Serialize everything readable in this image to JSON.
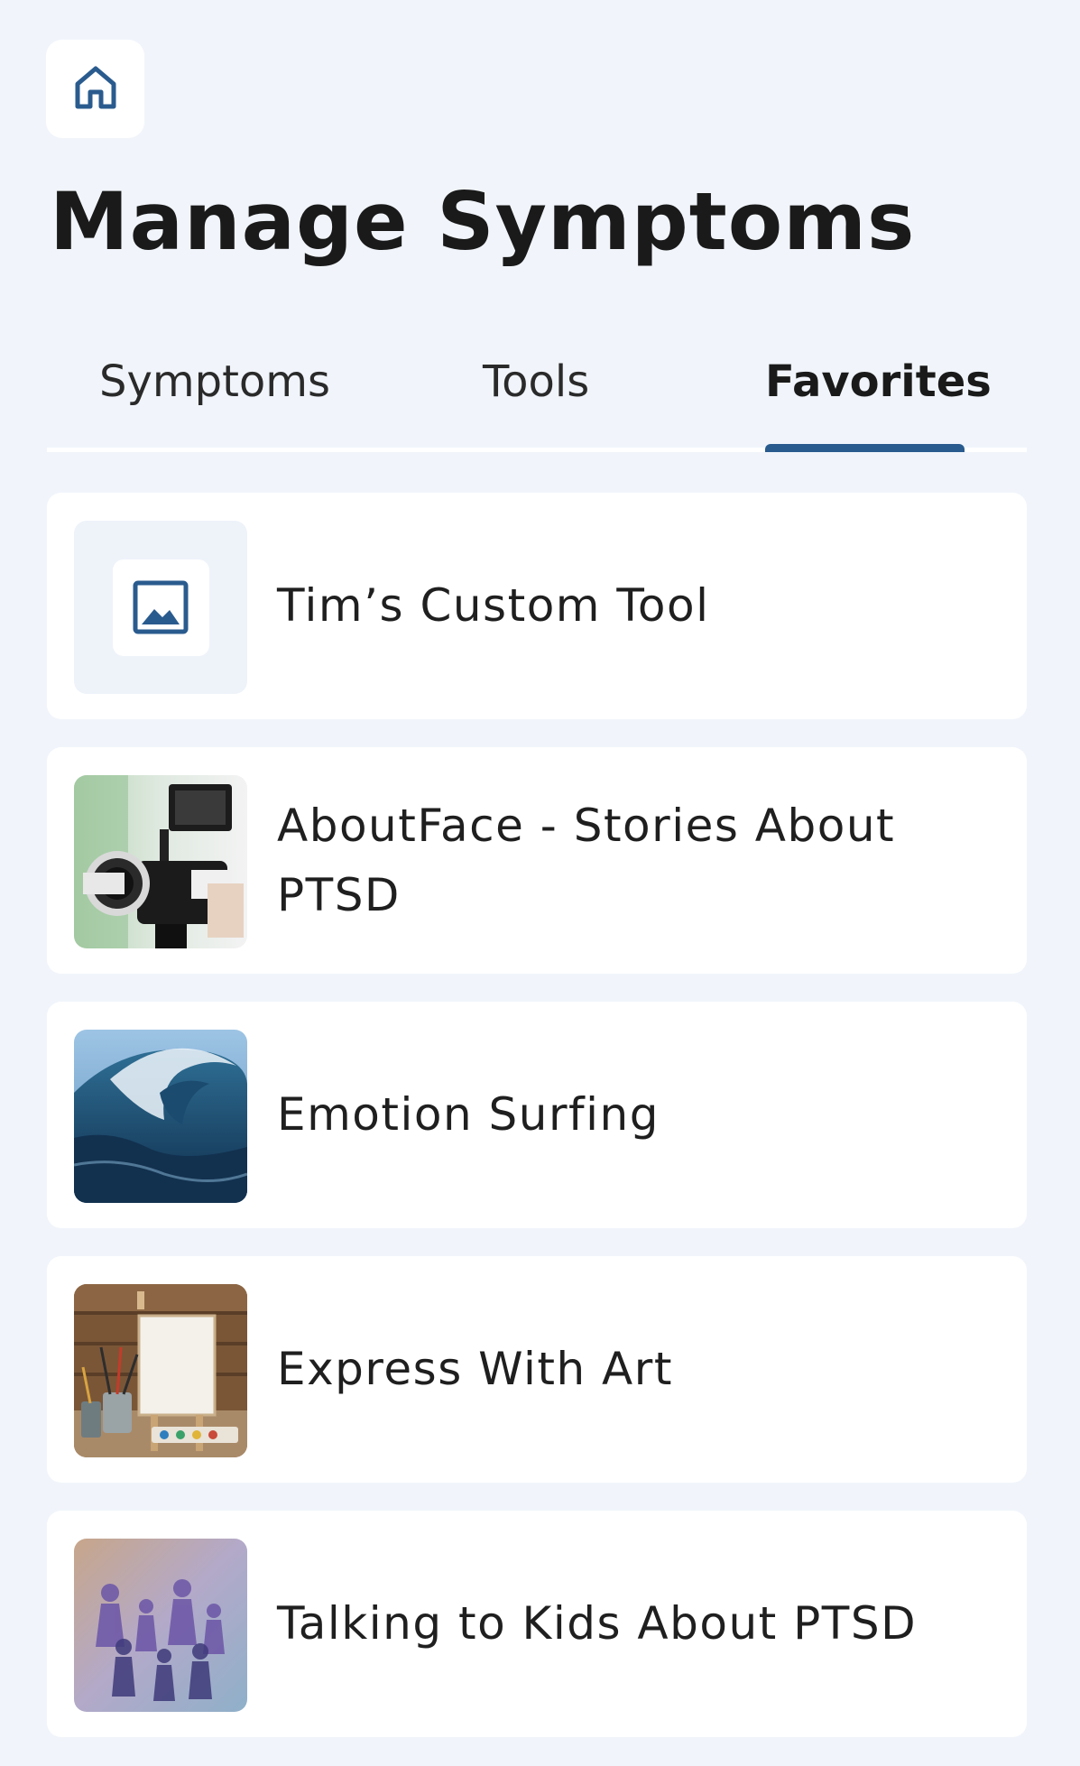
{
  "header": {
    "home_icon": "home-icon",
    "title": "Manage Symptoms"
  },
  "tabs": [
    {
      "label": "Symptoms",
      "active": false
    },
    {
      "label": "Tools",
      "active": false
    },
    {
      "label": "Favorites",
      "active": true
    }
  ],
  "colors": {
    "background": "#f1f5fb",
    "accent": "#2a5b8e",
    "card": "#ffffff",
    "text": "#1f1f1f"
  },
  "favorites": [
    {
      "title": "Tim’s Custom Tool",
      "thumbnail": "image-placeholder-icon"
    },
    {
      "title": "AboutFace - Stories About PTSD",
      "thumbnail": "video-camera-photo"
    },
    {
      "title": "Emotion Surfing",
      "thumbnail": "ocean-wave-photo"
    },
    {
      "title": "Express With Art",
      "thumbnail": "easel-and-brushes-photo"
    },
    {
      "title": "Talking to Kids About PTSD",
      "thumbnail": "paper-family-chain-photo"
    }
  ]
}
